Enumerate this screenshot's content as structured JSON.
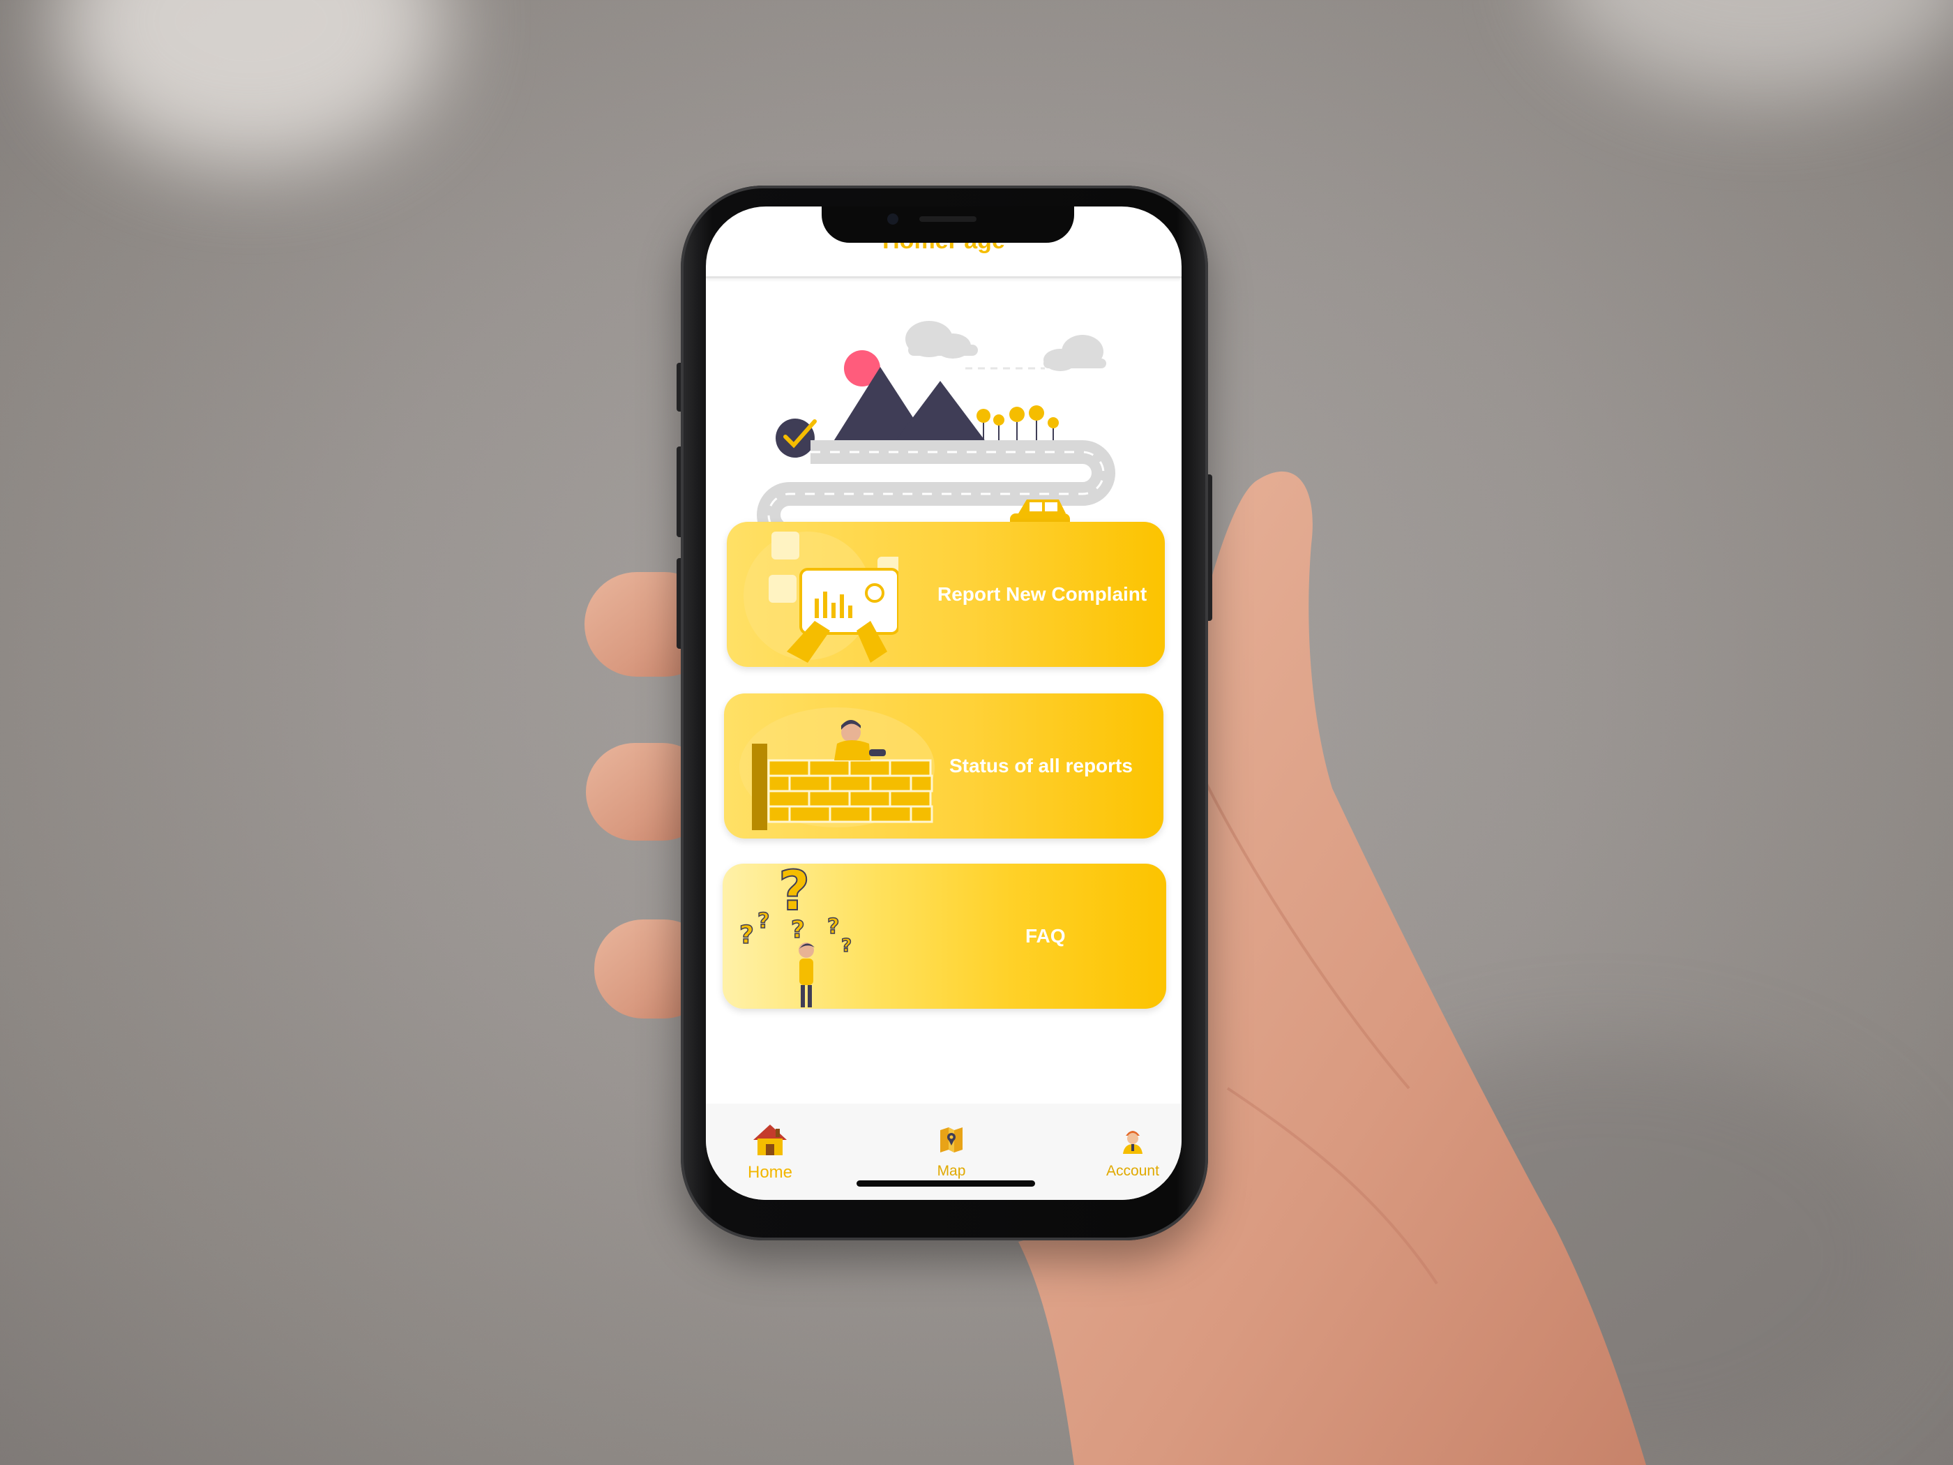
{
  "app": {
    "title": "HomePage",
    "accent_color": "#FFC107"
  },
  "cards": [
    {
      "label": "Report New Complaint",
      "icon": "tablet-chart-illustration"
    },
    {
      "label": "Status of all reports",
      "icon": "brick-wall-worker-illustration"
    },
    {
      "label": "FAQ",
      "icon": "question-marks-illustration"
    }
  ],
  "bottom_nav": {
    "items": [
      {
        "label": "Home",
        "icon": "home-icon",
        "active": true
      },
      {
        "label": "Map",
        "icon": "map-icon",
        "active": false
      },
      {
        "label": "Account",
        "icon": "account-icon",
        "active": false
      }
    ]
  }
}
